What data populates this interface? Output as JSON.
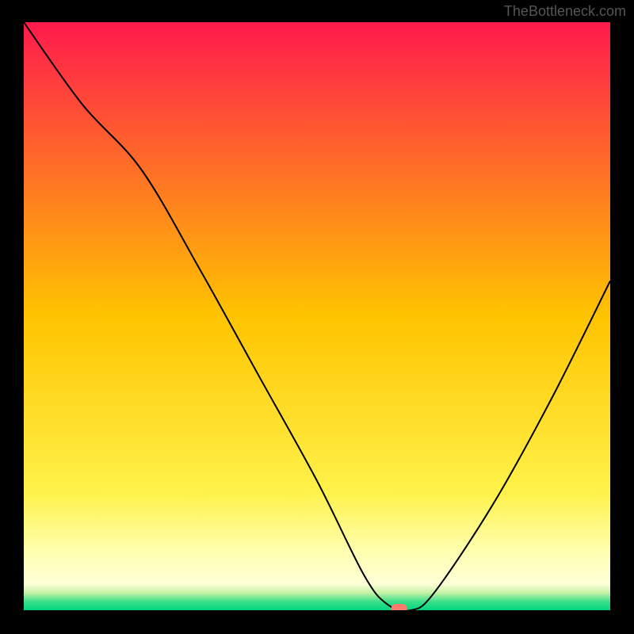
{
  "watermark": "TheBottleneck.com",
  "chart_data": {
    "type": "line",
    "title": "",
    "xlabel": "",
    "ylabel": "",
    "xlim": [
      0,
      100
    ],
    "ylim": [
      0,
      100
    ],
    "series": [
      {
        "name": "curve",
        "x": [
          0,
          10,
          20,
          30,
          40,
          50,
          58,
          62,
          66,
          70,
          80,
          90,
          100
        ],
        "values": [
          100,
          86,
          75,
          58,
          40,
          22,
          6,
          1,
          0,
          3,
          18,
          36,
          56
        ]
      }
    ],
    "marker": {
      "x": 64,
      "y": 0,
      "color": "#ff7a6a"
    },
    "background_gradient": {
      "stops": [
        {
          "offset": 0.0,
          "color": "#ff1a4d"
        },
        {
          "offset": 0.5,
          "color": "#ffc400"
        },
        {
          "offset": 0.8,
          "color": "#fff24a"
        },
        {
          "offset": 0.9,
          "color": "#ffffb0"
        },
        {
          "offset": 0.955,
          "color": "#ffffd8"
        },
        {
          "offset": 0.97,
          "color": "#c7f2a6"
        },
        {
          "offset": 0.985,
          "color": "#3fe08a"
        },
        {
          "offset": 1.0,
          "color": "#00d47f"
        }
      ]
    }
  }
}
